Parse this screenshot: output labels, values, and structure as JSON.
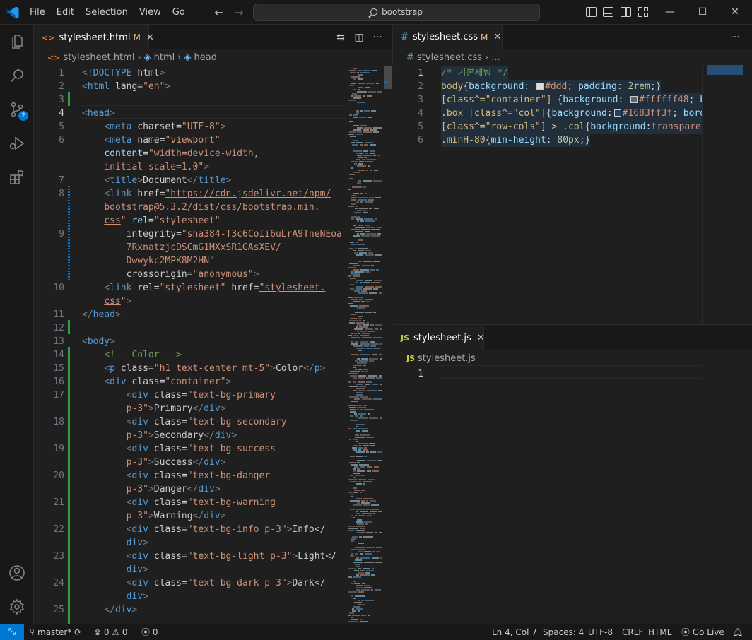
{
  "menu": [
    "File",
    "Edit",
    "Selection",
    "View",
    "Go"
  ],
  "command_center": {
    "text": "bootstrap"
  },
  "activity": {
    "scm_badge": "2"
  },
  "left_editor": {
    "tab": {
      "icon": "<>",
      "name": "stylesheet.html",
      "status": "M"
    },
    "breadcrumb": [
      "stylesheet.html",
      "html",
      "head"
    ],
    "lines": [
      {
        "n": "1",
        "t": "<!DOCTYPE html>"
      },
      {
        "n": "2",
        "t": "<html lang=\"en\">"
      },
      {
        "n": "3",
        "t": ""
      },
      {
        "n": "4",
        "t": "<head>"
      },
      {
        "n": "5",
        "t": "    <meta charset=\"UTF-8\">"
      },
      {
        "n": "6",
        "t": "    <meta name=\"viewport\""
      },
      {
        "n": "",
        "t": "    content=\"width=device-width,"
      },
      {
        "n": "",
        "t": "    initial-scale=1.0\">"
      },
      {
        "n": "7",
        "t": "    <title>Document</title>"
      },
      {
        "n": "8",
        "t": "    <link href=\"https://cdn.jsdelivr.net/npm/"
      },
      {
        "n": "",
        "t": "    bootstrap@5.3.2/dist/css/bootstrap.min."
      },
      {
        "n": "",
        "t": "    css\" rel=\"stylesheet\""
      },
      {
        "n": "9",
        "t": "        integrity=\"sha384-T3c6CoIi6uLrA9TneNEoa"
      },
      {
        "n": "",
        "t": "        7RxnatzjcDSCmG1MXxSR1GAsXEV/"
      },
      {
        "n": "",
        "t": "        Dwwykc2MPK8M2HN\""
      },
      {
        "n": "",
        "t": "        crossorigin=\"anonymous\">"
      },
      {
        "n": "10",
        "t": "    <link rel=\"stylesheet\" href=\"stylesheet."
      },
      {
        "n": "",
        "t": "    css\">"
      },
      {
        "n": "11",
        "t": "</head>"
      },
      {
        "n": "12",
        "t": ""
      },
      {
        "n": "13",
        "t": "<body>"
      },
      {
        "n": "14",
        "t": "    <!-- Color -->"
      },
      {
        "n": "15",
        "t": "    <p class=\"h1 text-center mt-5\">Color</p>"
      },
      {
        "n": "16",
        "t": "    <div class=\"container\">"
      },
      {
        "n": "17",
        "t": "        <div class=\"text-bg-primary"
      },
      {
        "n": "",
        "t": "        p-3\">Primary</div>"
      },
      {
        "n": "18",
        "t": "        <div class=\"text-bg-secondary"
      },
      {
        "n": "",
        "t": "        p-3\">Secondary</div>"
      },
      {
        "n": "19",
        "t": "        <div class=\"text-bg-success"
      },
      {
        "n": "",
        "t": "        p-3\">Success</div>"
      },
      {
        "n": "20",
        "t": "        <div class=\"text-bg-danger"
      },
      {
        "n": "",
        "t": "        p-3\">Danger</div>"
      },
      {
        "n": "21",
        "t": "        <div class=\"text-bg-warning"
      },
      {
        "n": "",
        "t": "        p-3\">Warning</div>"
      },
      {
        "n": "22",
        "t": "        <div class=\"text-bg-info p-3\">Info</"
      },
      {
        "n": "",
        "t": "        div>"
      },
      {
        "n": "23",
        "t": "        <div class=\"text-bg-light p-3\">Light</"
      },
      {
        "n": "",
        "t": "        div>"
      },
      {
        "n": "24",
        "t": "        <div class=\"text-bg-dark p-3\">Dark</"
      },
      {
        "n": "",
        "t": "        div>"
      },
      {
        "n": "25",
        "t": "    </div>"
      }
    ]
  },
  "css_editor": {
    "tab": {
      "icon": "#",
      "name": "stylesheet.css",
      "status": "M"
    },
    "breadcrumb": [
      "stylesheet.css",
      "..."
    ],
    "lines": [
      {
        "n": "1",
        "t": "/* 기본세팅 */"
      },
      {
        "n": "2",
        "t": "body{background:  #ddd; padding: 2rem;}"
      },
      {
        "n": "3",
        "t": "[class^=\"container\"] {background:  #ffffff48; b"
      },
      {
        "n": "4",
        "t": ".box [class^=\"col\"]{background: #1683ff3f; bord"
      },
      {
        "n": "5",
        "t": "[class^=\"row-cols\"] > .col{background:transparen"
      },
      {
        "n": "6",
        "t": ".minH-80{min-height: 80px;}"
      }
    ],
    "swatches": {
      "ddd": "#dddddd",
      "ffffff48": "#ffffff48",
      "1683ff3f": "#1683ff3f"
    }
  },
  "js_editor": {
    "tab": {
      "icon": "JS",
      "name": "stylesheet.js"
    },
    "breadcrumb": [
      "stylesheet.js"
    ],
    "lines": [
      {
        "n": "1",
        "t": ""
      }
    ]
  },
  "status": {
    "branch": "master*",
    "errors": "0",
    "warnings": "0",
    "ports": "0",
    "position": "Ln 4, Col 7",
    "spaces": "Spaces: 4",
    "encoding": "UTF-8",
    "eol": "CRLF",
    "language": "HTML",
    "golive": "Go Live"
  },
  "colors": {
    "accent": "#0078d4",
    "modified": "#e2c08d",
    "added": "#2ea043"
  }
}
